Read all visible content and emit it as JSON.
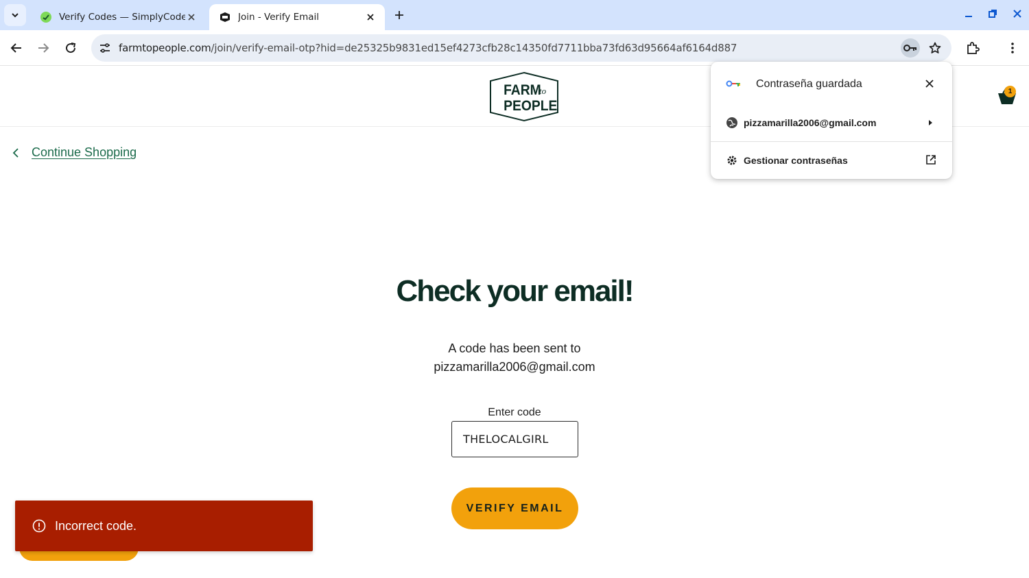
{
  "browser": {
    "tabs": [
      {
        "title": "Verify Codes — SimplyCodes",
        "active": false
      },
      {
        "title": "Join - Verify Email",
        "active": true
      }
    ],
    "url_domain": "farmtopeople.com",
    "url_path": "/join/verify-email-otp?hid=de25325b9831ed15ef4273cfb28c14350fd7711bba73fd63d95664af6164d887"
  },
  "password_popup": {
    "title": "Contraseña guardada",
    "account": "pizzamarilla2006@gmail.com",
    "manage_label": "Gestionar contraseñas"
  },
  "page": {
    "logo_text": [
      "FARM",
      "to",
      "PEOPLE"
    ],
    "cart_count": "1",
    "continue_label": "Continue Shopping",
    "headline": "Check your email!",
    "sent_line_1": "A code has been sent to",
    "sent_line_2": "pizzamarilla2006@gmail.com",
    "code_label": "Enter code",
    "code_value": "THELOCALGIRL",
    "verify_label": "VERIFY EMAIL"
  },
  "toast": {
    "message": "Incorrect code.",
    "color": "#a81e00"
  },
  "colors": {
    "accent": "#f2a10c",
    "brand_green": "#0d2d24",
    "link_green": "#1a6a4a",
    "tabstrip": "#d3e3fd"
  }
}
